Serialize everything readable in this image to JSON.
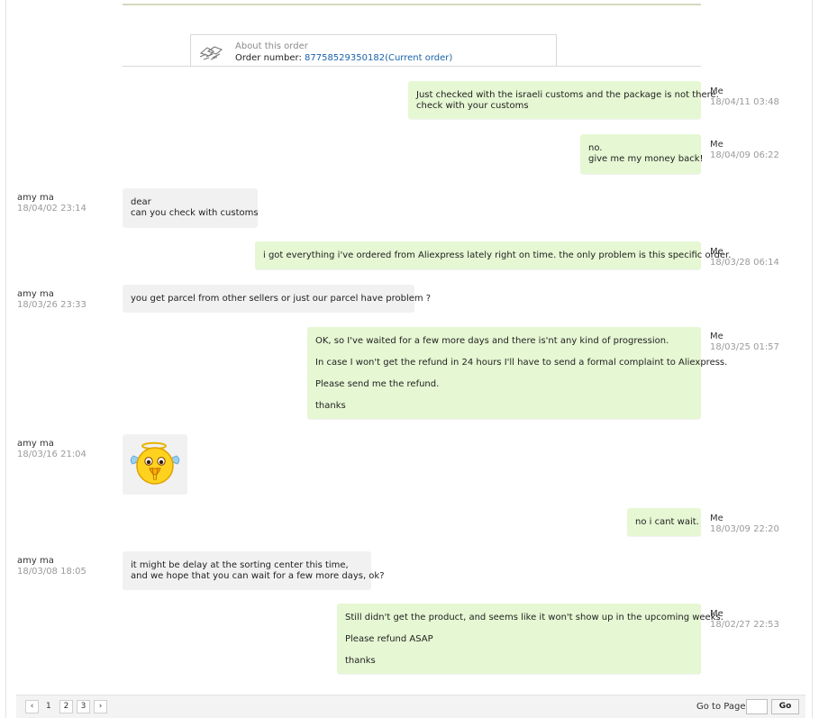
{
  "order": {
    "title": "About this order",
    "number_label": "Order number: ",
    "number": "87758529350182",
    "current_label": "(Current order)"
  },
  "messages": [
    {
      "sender": "Me",
      "time": "18/04/11 03:48",
      "lines": [
        "Just checked with the israeli customs and the package is not there.",
        "check with your customs"
      ]
    },
    {
      "sender": "Me",
      "time": "18/04/09 06:22",
      "lines": [
        "no.",
        "give me my money back!"
      ]
    },
    {
      "sender": "amy ma",
      "time": "18/04/02 23:14",
      "lines": [
        "dear",
        "can you check with customs"
      ]
    },
    {
      "sender": "Me",
      "time": "18/03/28 06:14",
      "lines": [
        "i got everything i've ordered from Aliexpress lately right on time. the only problem is this specific order."
      ]
    },
    {
      "sender": "amy ma",
      "time": "18/03/26 23:33",
      "lines": [
        "you get parcel from other sellers or just our parcel have problem ?"
      ]
    },
    {
      "sender": "Me",
      "time": "18/03/25 01:57",
      "paragraphs": [
        "OK, so I've waited for a few more days and there is'nt any kind of progression.",
        "In case I won't get the refund in 24 hours I'll have to send a formal complaint to Aliexpress.",
        "Please send me the refund.",
        "thanks"
      ]
    },
    {
      "sender": "amy ma",
      "time": "18/03/16 21:04",
      "emoji": "praying-angel-emoji"
    },
    {
      "sender": "Me",
      "time": "18/03/09 22:20",
      "lines": [
        "no i cant wait."
      ]
    },
    {
      "sender": "amy ma",
      "time": "18/03/08 18:05",
      "lines": [
        "it might be delay at the sorting center this time,",
        "and we hope that you can wait for a few more days, ok?"
      ]
    },
    {
      "sender": "Me",
      "time": "18/02/27 22:53",
      "paragraphs": [
        "Still didn't get the product, and seems like it won't show up in the upcoming weeks.",
        "Please refund ASAP",
        "thanks"
      ]
    }
  ],
  "pagination": {
    "prev": "‹",
    "pages": [
      "1",
      "2",
      "3"
    ],
    "next": "›",
    "goto_label": "Go to Page",
    "goto_value": "",
    "go_label": "Go"
  },
  "colors": {
    "me_bubble": "#e6f7d3",
    "them_bubble": "#f1f1f1",
    "link": "#1a62a8"
  }
}
